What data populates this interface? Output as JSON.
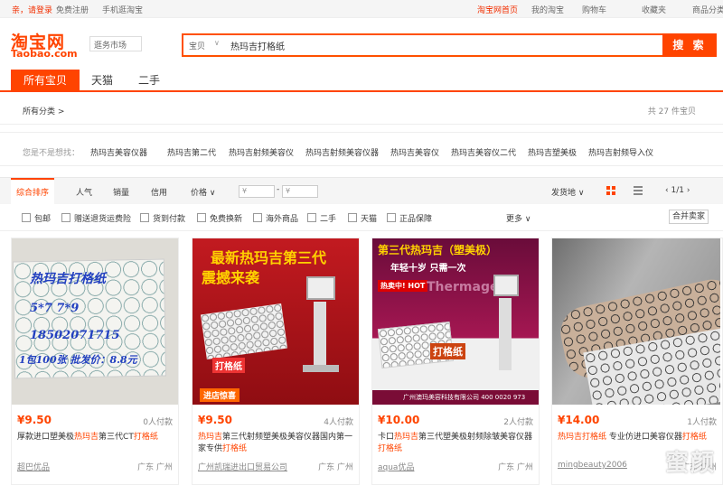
{
  "topbar": {
    "login": "亲，请登录",
    "register": "免费注册",
    "mobile": "手机逛淘宝",
    "home": "淘宝网首页",
    "my_taobao": "我的淘宝",
    "cart": "购物车",
    "favorites": "收藏夹",
    "more": "商品分类"
  },
  "header": {
    "logo_cn": "淘宝网",
    "logo_en": "Taobao.com",
    "market": "逛务市场"
  },
  "search": {
    "category": "宝贝",
    "query": "热玛吉打格纸",
    "button": "搜 索"
  },
  "tabs": [
    {
      "label": "所有宝贝",
      "active": true
    },
    {
      "label": "天猫"
    },
    {
      "label": "二手"
    }
  ],
  "breadcrumb": {
    "all_categories": "所有分类 >",
    "total": "共 27 件宝贝"
  },
  "suggest": {
    "label": "您是不是想找：",
    "items": [
      "热玛吉美容仪器",
      "热玛吉第二代",
      "热玛吉射频美容仪",
      "热玛吉射频美容仪器",
      "热玛吉美容仪",
      "热玛吉美容仪二代",
      "热玛吉塑美极",
      "热玛吉射频导入仪"
    ]
  },
  "sort": {
    "default": "综合排序",
    "popularity": "人气",
    "sales": "销量",
    "credit": "信用",
    "price": "价格",
    "price_from": "¥",
    "price_to": "¥",
    "ship_from": "发货地",
    "pager": "1/1"
  },
  "filters": [
    "包邮",
    "赠送退货运费险",
    "货到付款",
    "免费换新",
    "海外商品",
    "二手",
    "天猫",
    "正品保障"
  ],
  "filters_more": "更多",
  "merge_sellers": "合并卖家",
  "products": [
    {
      "price": "¥9.50",
      "sold": "0人付款",
      "title_pre": "厚款进口塑美极",
      "title_hl": "热玛吉",
      "title_mid": "第三代CT",
      "title_end": "打格纸",
      "shop": "超巴优品",
      "loc": "广东 广州",
      "img_lines": [
        "热玛吉打格纸",
        "5*7    7*9",
        "18502071715",
        "1包100张 批发价：8.8元"
      ]
    },
    {
      "price": "¥9.50",
      "sold": "4人付款",
      "title_pre": "",
      "title_hl": "热玛吉",
      "title_mid": "第三代射频塑美极美容仪器国内第一家专供",
      "title_end": "打格纸",
      "shop": "广州凯瑞进出口贸易公司",
      "loc": "广东 广州",
      "img_t1": "最新热玛吉第三代",
      "img_t2": "震撼来袭",
      "img_tag": "打格纸",
      "img_store": "进店惊喜"
    },
    {
      "price": "¥10.00",
      "sold": "2人付款",
      "title_pre": "卡口",
      "title_hl": "热玛吉",
      "title_mid": "第三代塑美极射频除皱美容仪器",
      "title_end": "打格纸",
      "shop": "aqua优品",
      "loc": "广东 广州",
      "img_t1": "第三代热玛吉（塑美极）",
      "img_t2": "年轻十岁 只需一次",
      "img_hot": "热卖中! HOT",
      "img_brand": "Thermage",
      "img_lbl": "打格纸",
      "img_co": "广州澳玛美容科技有限公司 400 0020 973"
    },
    {
      "price": "¥14.00",
      "sold": "1人付款",
      "title_pre": "",
      "title_hl": "热玛吉打格纸",
      "title_mid": " 专业仿进口美容仪器",
      "title_end": "打格纸",
      "shop": "mingbeauty2006",
      "loc": "广东 广州"
    }
  ],
  "watermark": "蜜颜",
  "colors": {
    "accent": "#ff4400",
    "price": "#ff4400"
  }
}
